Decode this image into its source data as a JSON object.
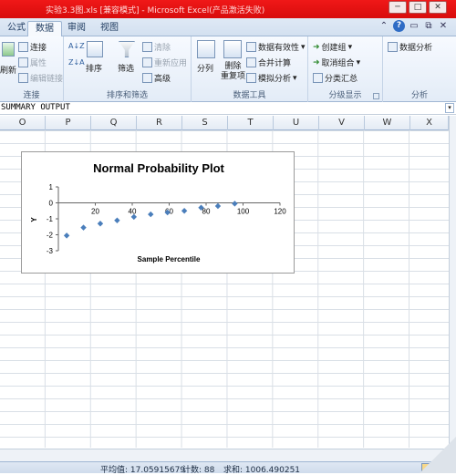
{
  "window": {
    "title": "实验3.3图.xls  [兼容模式]  -  Microsoft Excel(产品激活失败)",
    "controls": [
      "─",
      "□",
      "✕"
    ]
  },
  "tabs": [
    "公式",
    "数据",
    "审阅",
    "视图"
  ],
  "active_tab": "数据",
  "ribbon": {
    "connections": {
      "refresh_label": "刷新",
      "connections_label": "连接",
      "properties_label": "属性",
      "edit_links_label": "编辑链接",
      "group_label": "连接"
    },
    "sort_filter": {
      "sort_label": "排序",
      "filter_label": "筛选",
      "clear_label": "清除",
      "reapply_label": "重新应用",
      "advanced_label": "高级",
      "group_label": "排序和筛选"
    },
    "data_tools": {
      "text_to_columns_label": "分列",
      "remove_duplicates_label": "删除\n重复项",
      "data_validation_label": "数据有效性",
      "consolidate_label": "合并计算",
      "what_if_label": "模拟分析",
      "group_label": "数据工具"
    },
    "outline": {
      "group_label_btn": "创建组",
      "ungroup_label": "取消组合",
      "subtotal_label": "分类汇总",
      "group_label": "分级显示"
    },
    "analysis": {
      "data_analysis_label": "数据分析",
      "group_label": "分析"
    }
  },
  "formula_bar": {
    "content": "SUMMARY OUTPUT"
  },
  "columns": [
    "O",
    "P",
    "Q",
    "R",
    "S",
    "T",
    "U",
    "V",
    "W",
    "X"
  ],
  "status_bar": {
    "average": "平均值: 17.05915679",
    "count": "计数: 88",
    "sum": "求和: 1006.490251"
  },
  "colors": {
    "series": "#4a7ebb",
    "titlebar": "#e01414"
  },
  "chart_data": {
    "type": "scatter",
    "title": "Normal Probability Plot",
    "xlabel": "Sample Percentile",
    "ylabel": "Y",
    "xlim": [
      0,
      120
    ],
    "ylim": [
      -3,
      1
    ],
    "xticks": [
      0,
      20,
      40,
      60,
      80,
      100,
      120
    ],
    "yticks": [
      -3,
      -2,
      -1,
      0,
      1
    ],
    "legend": "none",
    "series": [
      {
        "x": [
          4.5,
          13.6,
          22.7,
          31.8,
          40.9,
          50,
          59.1,
          68.2,
          77.3,
          86.4,
          95.5
        ],
        "values": [
          -2.05,
          -1.55,
          -1.3,
          -1.1,
          -0.88,
          -0.72,
          -0.6,
          -0.5,
          -0.3,
          -0.2,
          -0.05
        ]
      }
    ]
  }
}
